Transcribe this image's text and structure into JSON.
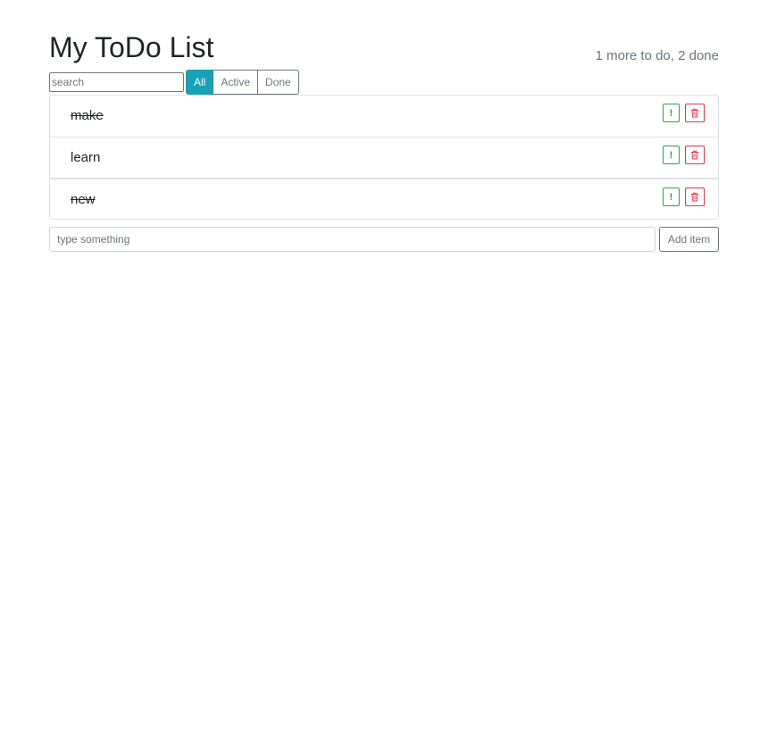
{
  "header": {
    "title": "My ToDo List",
    "status": "1 more to do, 2 done"
  },
  "search": {
    "placeholder": "search",
    "value": ""
  },
  "filters": [
    {
      "label": "All",
      "active": true
    },
    {
      "label": "Active",
      "active": false
    },
    {
      "label": "Done",
      "active": false
    }
  ],
  "todos": [
    {
      "label": "make",
      "done": true,
      "important": false
    },
    {
      "label": "learn",
      "done": false,
      "important": false
    },
    {
      "label": "new",
      "done": true,
      "important": false
    }
  ],
  "icons": {
    "important": "exclamation-icon",
    "delete": "trash-icon",
    "important_glyph": "!"
  },
  "add": {
    "placeholder": "type something",
    "value": "",
    "button_label": "Add item"
  },
  "colors": {
    "accent": "#17a2b8",
    "success": "#28a745",
    "danger": "#dc3545",
    "muted": "#6c757d"
  }
}
